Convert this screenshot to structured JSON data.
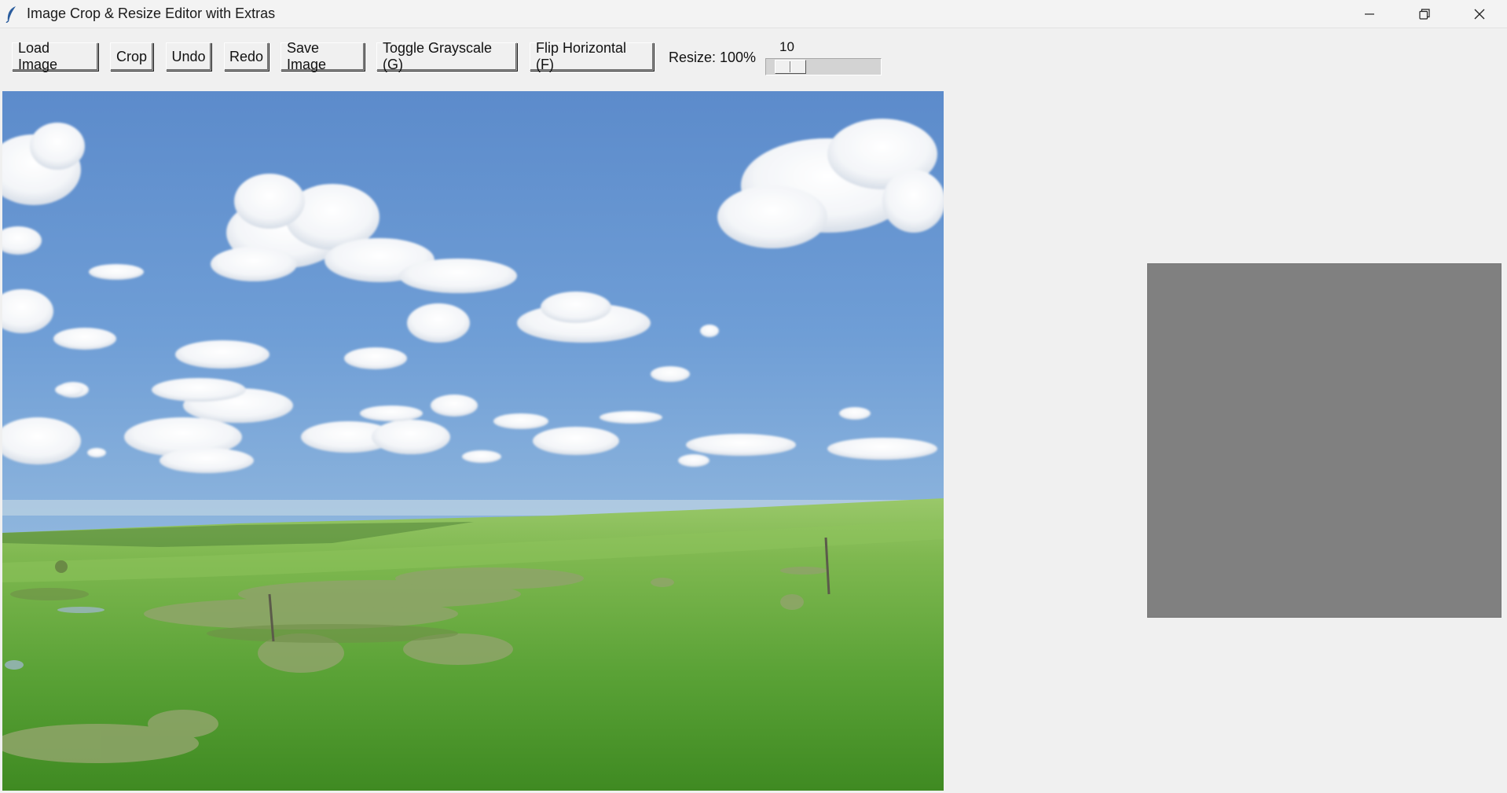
{
  "window": {
    "title": "Image Crop & Resize Editor with Extras",
    "app_icon": "feather-icon",
    "controls": [
      "minimize-icon",
      "restore-icon",
      "close-icon"
    ]
  },
  "toolbar": {
    "load_label": "Load Image",
    "crop_label": "Crop",
    "undo_label": "Undo",
    "redo_label": "Redo",
    "save_label": "Save Image",
    "grayscale_label": "Toggle Grayscale (G)",
    "flip_label": "Flip Horizontal (F)",
    "resize_label": "Resize: 100%"
  },
  "slider": {
    "value": "10",
    "fraction": 0.1
  },
  "canvas": {
    "image_description_icon": "landscape-photo",
    "colors": {
      "sky_top": "#5f8fcf",
      "sky_bottom": "#a8c8e4",
      "grass_light": "#8cc451",
      "grass_dark": "#3f8a22"
    }
  },
  "preview": {
    "color": "#808080"
  }
}
